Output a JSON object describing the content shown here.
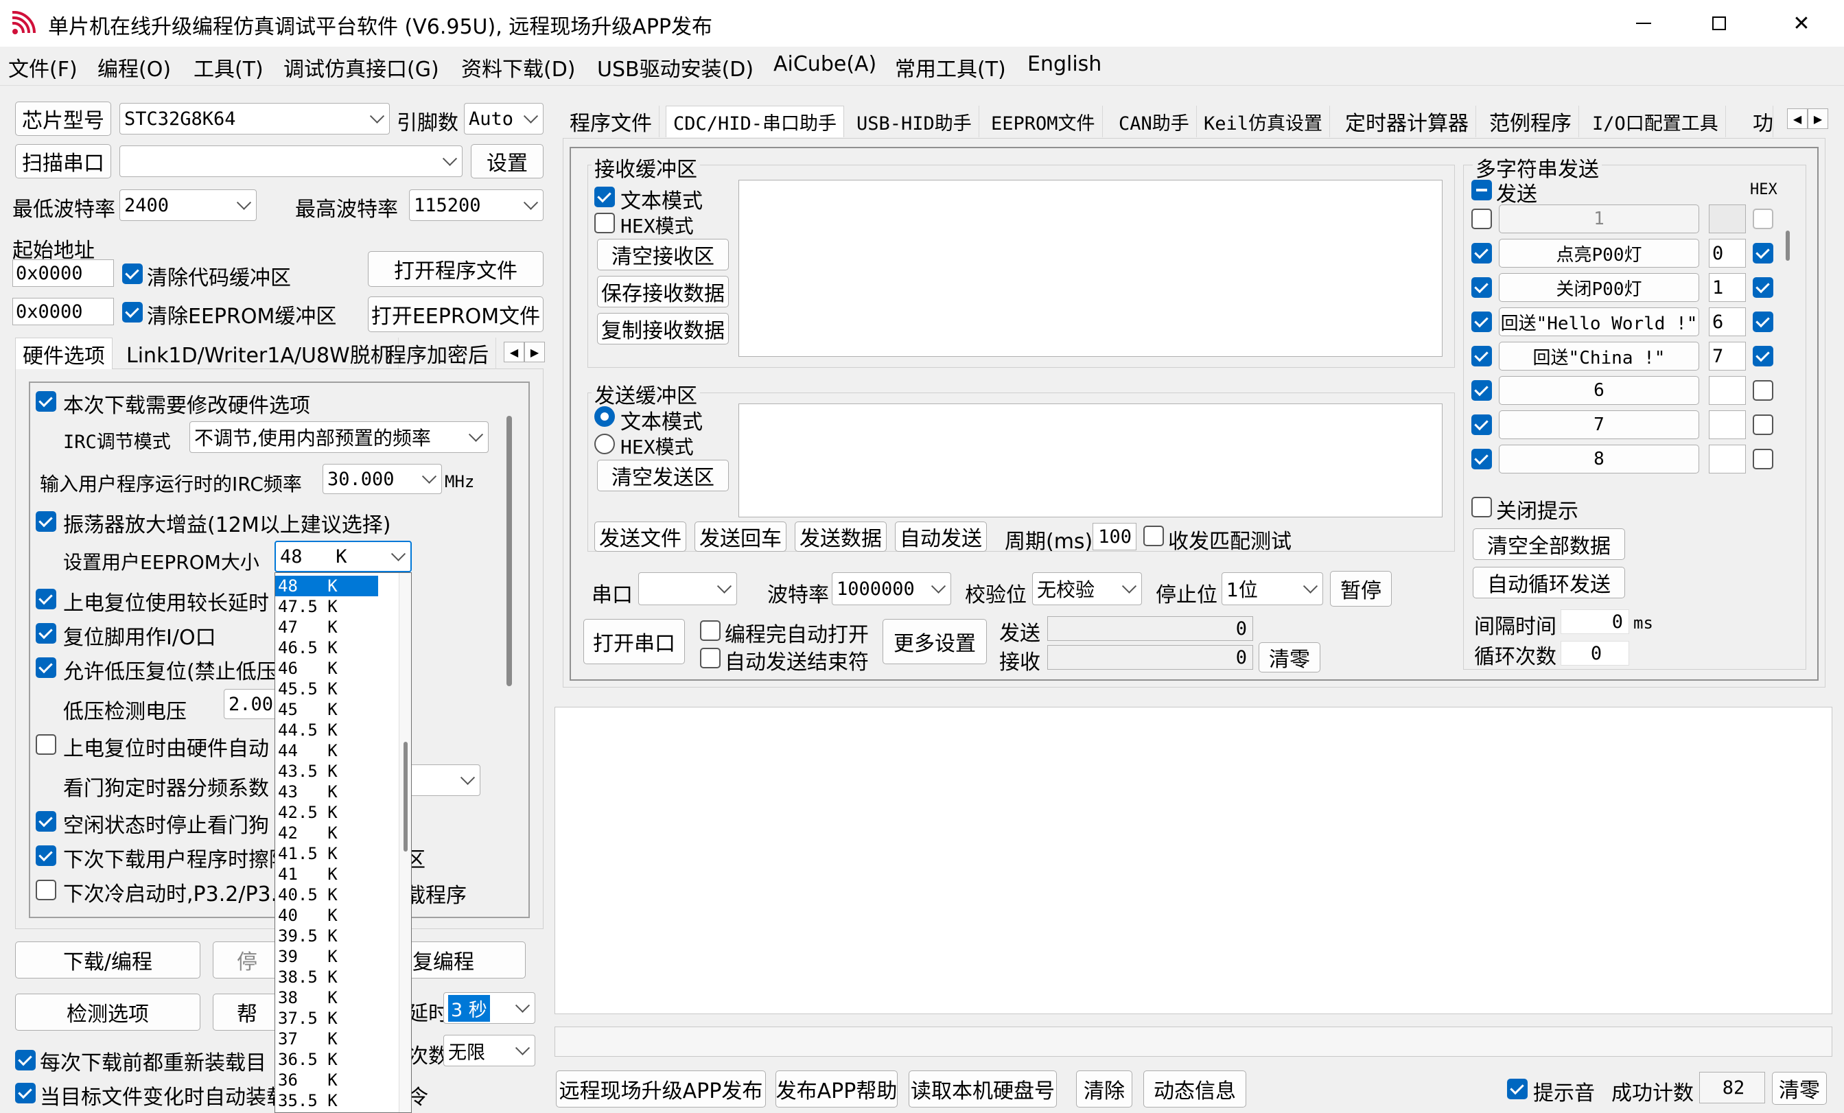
{
  "window": {
    "title": "单片机在线升级编程仿真调试平台软件 (V6.95U), 远程现场升级APP发布",
    "minimize": "—",
    "maximize": "☐",
    "close": "✕"
  },
  "menu": [
    "文件(F)",
    "编程(O)",
    "工具(T)",
    "调试仿真接口(G)",
    "资料下载(D)",
    "USB驱动安装(D)",
    "AiCube(A)",
    "常用工具(T)",
    "English"
  ],
  "left": {
    "chip_button": "芯片型号",
    "chip_value": "STC32G8K64",
    "pin_label": "引脚数",
    "pin_value": "Auto",
    "scan_button": "扫描串口",
    "port_value": "",
    "settings_button": "设置",
    "min_baud_label": "最低波特率",
    "min_baud_value": "2400",
    "max_baud_label": "最高波特率",
    "max_baud_value": "115200",
    "start_addr_label": "起始地址",
    "addr1": "0x0000",
    "clear_code_label": "清除代码缓冲区",
    "open_prog_button": "打开程序文件",
    "addr2": "0x0000",
    "clear_eeprom_label": "清除EEPROM缓冲区",
    "open_eeprom_button": "打开EEPROM文件",
    "tabs": [
      "硬件选项",
      "Link1D/Writer1A/U8W脱机",
      "程序加密后"
    ],
    "hw": {
      "modify_hw": "本次下载需要修改硬件选项",
      "irc_mode_label": "IRC调节模式",
      "irc_mode_value": "不调节,使用内部预置的频率",
      "irc_freq_label": "输入用户程序运行时的IRC频率",
      "irc_freq_value": "30.000",
      "irc_unit": "MHz",
      "osc_gain": "振荡器放大增益(12M以上建议选择)",
      "eeprom_size_label": "设置用户EEPROM大小",
      "eeprom_size_value": "48   K",
      "power_reset": "上电复位使用较长延时",
      "reset_pin": "复位脚用作I/O口",
      "low_volt": "允许低压复位(禁止低压",
      "low_volt_label": "低压检测电压",
      "low_volt_value": "2.00",
      "hw_auto": "上电复位时由硬件自动",
      "wdt_label": "看门狗定时器分频系数",
      "idle_stop": "空闲状态时停止看门狗",
      "next_erase": "下次下载用户程序时擦除",
      "erase_tail": "区",
      "cold_boot": "下次冷启动时,P3.2/P3.",
      "cold_boot_tail": "载程序"
    },
    "download_button": "下载/编程",
    "stop_button": "停",
    "reprog_button": "复编程",
    "check_button": "检测选项",
    "help_button": "帮",
    "delay_label": "延时",
    "delay_value": "3 秒",
    "count_label": "次数",
    "count_value": "无限",
    "reload_label": "每次下载前都重新装载目",
    "auto_load_label": "当目标文件变化时自动装载",
    "auto_load_tail": "令"
  },
  "dropdown": {
    "selected": "48   K",
    "options": [
      "48   K",
      "47.5 K",
      "47   K",
      "46.5 K",
      "46   K",
      "45.5 K",
      "45   K",
      "44.5 K",
      "44   K",
      "43.5 K",
      "43   K",
      "42.5 K",
      "42   K",
      "41.5 K",
      "41   K",
      "40.5 K",
      "40   K",
      "39.5 K",
      "39   K",
      "38.5 K",
      "38   K",
      "37.5 K",
      "37   K",
      "36.5 K",
      "36   K",
      "35.5 K"
    ]
  },
  "right": {
    "tabs": [
      "程序文件",
      "CDC/HID-串口助手",
      "USB-HID助手",
      "EEPROM文件",
      "CAN助手",
      "Keil仿真设置",
      "定时器计算器",
      "范例程序",
      "I/O口配置工具",
      "功"
    ],
    "rx": {
      "title": "接收缓冲区",
      "text_mode": "文本模式",
      "hex_mode": "HEX模式",
      "clear": "清空接收区",
      "save": "保存接收数据",
      "copy": "复制接收数据"
    },
    "tx": {
      "title": "发送缓冲区",
      "text_mode": "文本模式",
      "hex_mode": "HEX模式",
      "clear": "清空发送区"
    },
    "send_file": "发送文件",
    "send_cr": "发送回车",
    "send_data": "发送数据",
    "auto_send": "自动发送",
    "period_label": "周期(ms)",
    "period_value": "100",
    "match_test": "收发匹配测试",
    "multi": {
      "title": "多字符串发送",
      "send_header": "发送",
      "hex_header": "HEX",
      "rows": [
        {
          "label": "1",
          "num": "",
          "checked": false,
          "hex": false,
          "disabled": true
        },
        {
          "label": "点亮P00灯",
          "num": "0",
          "checked": true,
          "hex": true
        },
        {
          "label": "关闭P00灯",
          "num": "1",
          "checked": true,
          "hex": true
        },
        {
          "label": "回送\"Hello World !\"",
          "num": "6",
          "checked": true,
          "hex": true
        },
        {
          "label": "回送\"China !\"",
          "num": "7",
          "checked": true,
          "hex": true
        },
        {
          "label": "6",
          "num": "",
          "checked": true,
          "hex": false
        },
        {
          "label": "7",
          "num": "",
          "checked": true,
          "hex": false
        },
        {
          "label": "8",
          "num": "",
          "checked": true,
          "hex": false
        }
      ],
      "close_hint": "关闭提示",
      "clear_all": "清空全部数据",
      "auto_loop": "自动循环发送",
      "interval_label": "间隔时间",
      "interval_value": "0",
      "interval_unit": "ms",
      "loop_label": "循环次数",
      "loop_value": "0"
    },
    "serial": {
      "port_label": "串口",
      "port_value": "",
      "baud_label": "波特率",
      "baud_value": "1000000",
      "parity_label": "校验位",
      "parity_value": "无校验",
      "stop_label": "停止位",
      "stop_value": "1位",
      "pause": "暂停",
      "open": "打开串口",
      "auto_open": "编程完自动打开",
      "auto_end": "自动发送结束符",
      "more": "更多设置",
      "send_label": "发送",
      "send_count": "0",
      "recv_label": "接收",
      "recv_count": "0",
      "clear": "清零"
    }
  },
  "bottom": {
    "remote": "远程现场升级APP发布",
    "help": "发布APP帮助",
    "read_hdd": "读取本机硬盘号",
    "clear": "清除",
    "dynamic": "动态信息",
    "tone_label": "提示音",
    "success_label": "成功计数",
    "success_value": "82",
    "reset": "清零"
  }
}
